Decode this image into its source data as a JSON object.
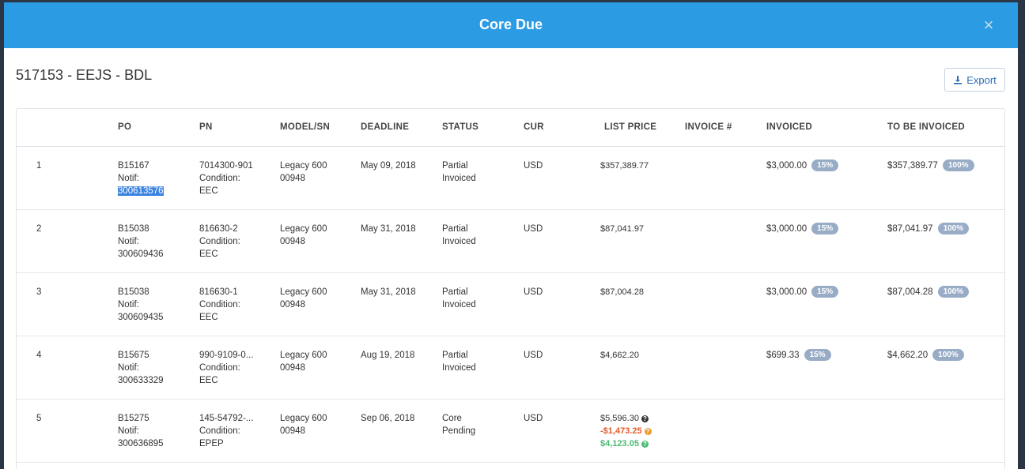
{
  "modal": {
    "title": "Core Due",
    "close_symbol": "×",
    "subtitle": "517153 - EEJS - BDL",
    "export_label": "Export"
  },
  "columns": {
    "po": "PO",
    "pn": "PN",
    "model_sn": "MODEL/SN",
    "deadline": "DEADLINE",
    "status": "STATUS",
    "cur": "CUR",
    "list_price": "LIST PRICE",
    "invoice_no": "INVOICE #",
    "invoiced": "INVOICED",
    "to_be_invoiced": "TO BE INVOICED"
  },
  "rows": [
    {
      "num": "1",
      "po": "B15167",
      "notif_label": "Notif:",
      "notif": "300613576",
      "pn": "7014300-901",
      "cond_label": "Condition:",
      "cond": "EEC",
      "model": "Legacy 600",
      "sn": "00948",
      "deadline": "May 09, 2018",
      "status1": "Partial",
      "status2": "Invoiced",
      "cur": "USD",
      "list_price": "$357,389.77",
      "invoiced": "$3,000.00",
      "invoiced_pct": "15%",
      "tbi": "$357,389.77",
      "tbi_pct": "100%"
    },
    {
      "num": "2",
      "po": "B15038",
      "notif_label": "Notif:",
      "notif": "300609436",
      "pn": "816630-2",
      "cond_label": "Condition:",
      "cond": "EEC",
      "model": "Legacy 600",
      "sn": "00948",
      "deadline": "May 31, 2018",
      "status1": "Partial",
      "status2": "Invoiced",
      "cur": "USD",
      "list_price": "$87,041.97",
      "invoiced": "$3,000.00",
      "invoiced_pct": "15%",
      "tbi": "$87,041.97",
      "tbi_pct": "100%"
    },
    {
      "num": "3",
      "po": "B15038",
      "notif_label": "Notif:",
      "notif": "300609435",
      "pn": "816630-1",
      "cond_label": "Condition:",
      "cond": "EEC",
      "model": "Legacy 600",
      "sn": "00948",
      "deadline": "May 31, 2018",
      "status1": "Partial",
      "status2": "Invoiced",
      "cur": "USD",
      "list_price": "$87,004.28",
      "invoiced": "$3,000.00",
      "invoiced_pct": "15%",
      "tbi": "$87,004.28",
      "tbi_pct": "100%"
    },
    {
      "num": "4",
      "po": "B15675",
      "notif_label": "Notif:",
      "notif": "300633329",
      "pn": "990-9109-0...",
      "cond_label": "Condition:",
      "cond": "EEC",
      "model": "Legacy 600",
      "sn": "00948",
      "deadline": "Aug 19, 2018",
      "status1": "Partial",
      "status2": "Invoiced",
      "cur": "USD",
      "list_price": "$4,662.20",
      "invoiced": "$699.33",
      "invoiced_pct": "15%",
      "tbi": "$4,662.20",
      "tbi_pct": "100%"
    },
    {
      "num": "5",
      "po": "B15275",
      "notif_label": "Notif:",
      "notif": "300636895",
      "pn": "145-54792-...",
      "cond_label": "Condition:",
      "cond": "EPEP",
      "model": "Legacy 600",
      "sn": "00948",
      "deadline": "Sep 06, 2018",
      "status1": "Core",
      "status2": "Pending",
      "cur": "USD",
      "list_price": "$5,596.30",
      "price_adj": "-$1,473.25",
      "price_net": "$4,123.05",
      "q_symbol": "?"
    }
  ]
}
